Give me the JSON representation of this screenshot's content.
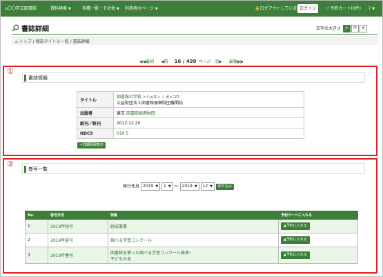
{
  "nav": {
    "home": "〇〇市立図書館",
    "items": [
      "資料検索",
      "各種一覧・その他",
      "利用者のページ"
    ],
    "logout": "ログアウトしています",
    "login": "ログイン",
    "cart": "予約カート(0件)",
    "help": "?"
  },
  "page": {
    "title": "書誌詳細",
    "font_size_label": "文字の大きさ",
    "font_sizes": [
      "小",
      "中",
      "大"
    ]
  },
  "breadcrumb": [
    "トップ",
    "雑誌タイトル一覧",
    "書誌詳細"
  ],
  "pager": {
    "first": "最初",
    "prev": "前",
    "current": "16 / 499",
    "unit": "ページ",
    "next": "次",
    "last": "最後"
  },
  "markers": [
    "①",
    "②"
  ],
  "biblio": {
    "heading": "書誌情報",
    "rows": [
      {
        "label": "タイトル",
        "value": "図書館の学校",
        "reading": "トショカン ノ ガッコウ",
        "publisher_line": "公益財団法人図書館振興財団機関誌"
      },
      {
        "label": "出版者",
        "value_prefix": "東京",
        "value": "図書館振興財団"
      },
      {
        "label": "創刊／終刊",
        "value": "2012.12.20"
      },
      {
        "label": "NDC9",
        "value": "010.5"
      }
    ],
    "detail_button": "＋詳細情報表示"
  },
  "volumes": {
    "heading": "巻号一覧",
    "filter": {
      "label": "発行年月",
      "from_year": "2019",
      "from_month": "1",
      "tilde": "〜",
      "to_year": "2019",
      "to_month": "12",
      "apply": "絞り込み"
    },
    "columns": [
      "No.",
      "巻号日号",
      "特集",
      "予約カートに入れる"
    ],
    "rows": [
      {
        "no": "1",
        "issue": "2019年秋号",
        "feature": "励成事業",
        "feature2": "",
        "button": "▲予約に入れる"
      },
      {
        "no": "2",
        "issue": "2019年夏号",
        "feature": "調べる学習コンクール",
        "feature2": "",
        "button": "▲予約に入れる"
      },
      {
        "no": "3",
        "issue": "2019年春号",
        "feature": "図書館を使った調べる学習コンクール発表!",
        "feature2": "子どもの本",
        "button": "▲予約に入れる"
      }
    ]
  },
  "colors": {
    "accent": "#3d7f3a",
    "highlight": "#e02020"
  }
}
